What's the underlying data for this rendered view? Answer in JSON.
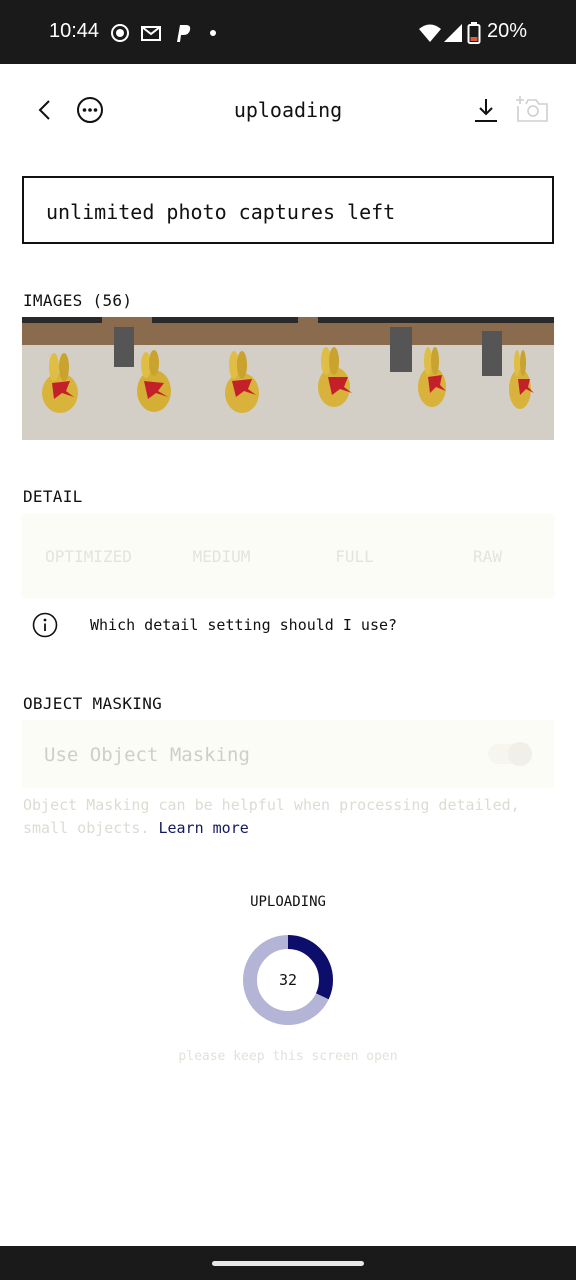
{
  "status_bar": {
    "time": "10:44",
    "battery": "20%",
    "icons": [
      "record-icon",
      "mail-icon",
      "paypal-icon",
      "wifi-icon",
      "signal-icon",
      "battery-icon"
    ]
  },
  "header": {
    "title": "uploading",
    "icons": [
      "back-icon",
      "more-icon",
      "download-icon",
      "add-camera-icon"
    ]
  },
  "captures": {
    "text": "unlimited photo captures left"
  },
  "images": {
    "label": "IMAGES (56)",
    "count_visible": 6
  },
  "detail": {
    "label": "DETAIL",
    "options": [
      "OPTIMIZED",
      "MEDIUM",
      "FULL",
      "RAW"
    ],
    "help_text": "Which detail setting should I use?"
  },
  "masking": {
    "label": "OBJECT MASKING",
    "toggle_label": "Use Object Masking",
    "description": "Object Masking can be helpful when processing detailed, small objects.",
    "learn_more": "Learn more"
  },
  "upload": {
    "label": "UPLOADING",
    "progress": 32,
    "note": "please keep this screen open"
  },
  "colors": {
    "accent": "#0d0d6b",
    "progress_track": "#b4b4d6",
    "status_bar": "#1a1a1a"
  }
}
